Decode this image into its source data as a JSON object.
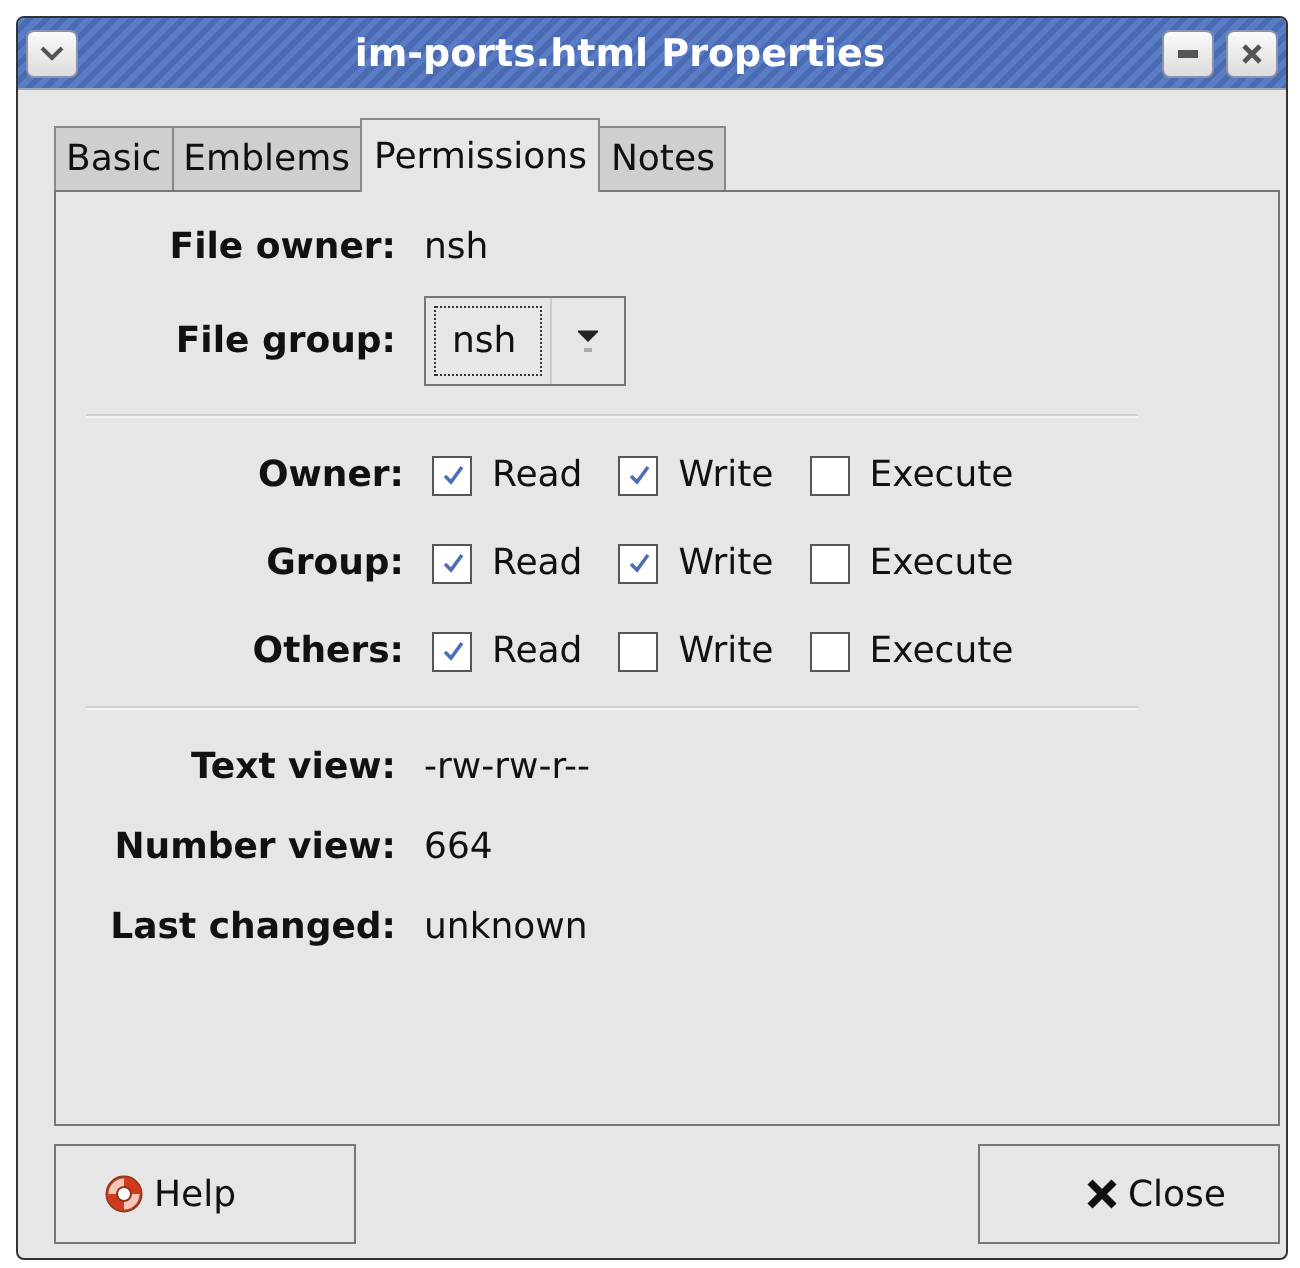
{
  "window": {
    "title": "im-ports.html Properties"
  },
  "tabs": [
    {
      "label": "Basic",
      "selected": false
    },
    {
      "label": "Emblems",
      "selected": false
    },
    {
      "label": "Permissions",
      "selected": true
    },
    {
      "label": "Notes",
      "selected": false
    }
  ],
  "file_owner": {
    "label": "File owner:",
    "value": "nsh"
  },
  "file_group": {
    "label": "File group:",
    "value": "nsh"
  },
  "permissions": [
    {
      "label": "Owner:",
      "options": [
        {
          "label": "Read",
          "checked": true
        },
        {
          "label": "Write",
          "checked": true
        },
        {
          "label": "Execute",
          "checked": false
        }
      ]
    },
    {
      "label": "Group:",
      "options": [
        {
          "label": "Read",
          "checked": true
        },
        {
          "label": "Write",
          "checked": true
        },
        {
          "label": "Execute",
          "checked": false
        }
      ]
    },
    {
      "label": "Others:",
      "options": [
        {
          "label": "Read",
          "checked": true
        },
        {
          "label": "Write",
          "checked": false
        },
        {
          "label": "Execute",
          "checked": false
        }
      ]
    }
  ],
  "info": [
    {
      "label": "Text view:",
      "value": "-rw-rw-r--"
    },
    {
      "label": "Number view:",
      "value": "664"
    },
    {
      "label": "Last changed:",
      "value": "unknown"
    }
  ],
  "buttons": [
    {
      "kind": "help",
      "label": "Help"
    },
    {
      "kind": "close",
      "label": "Close"
    }
  ]
}
